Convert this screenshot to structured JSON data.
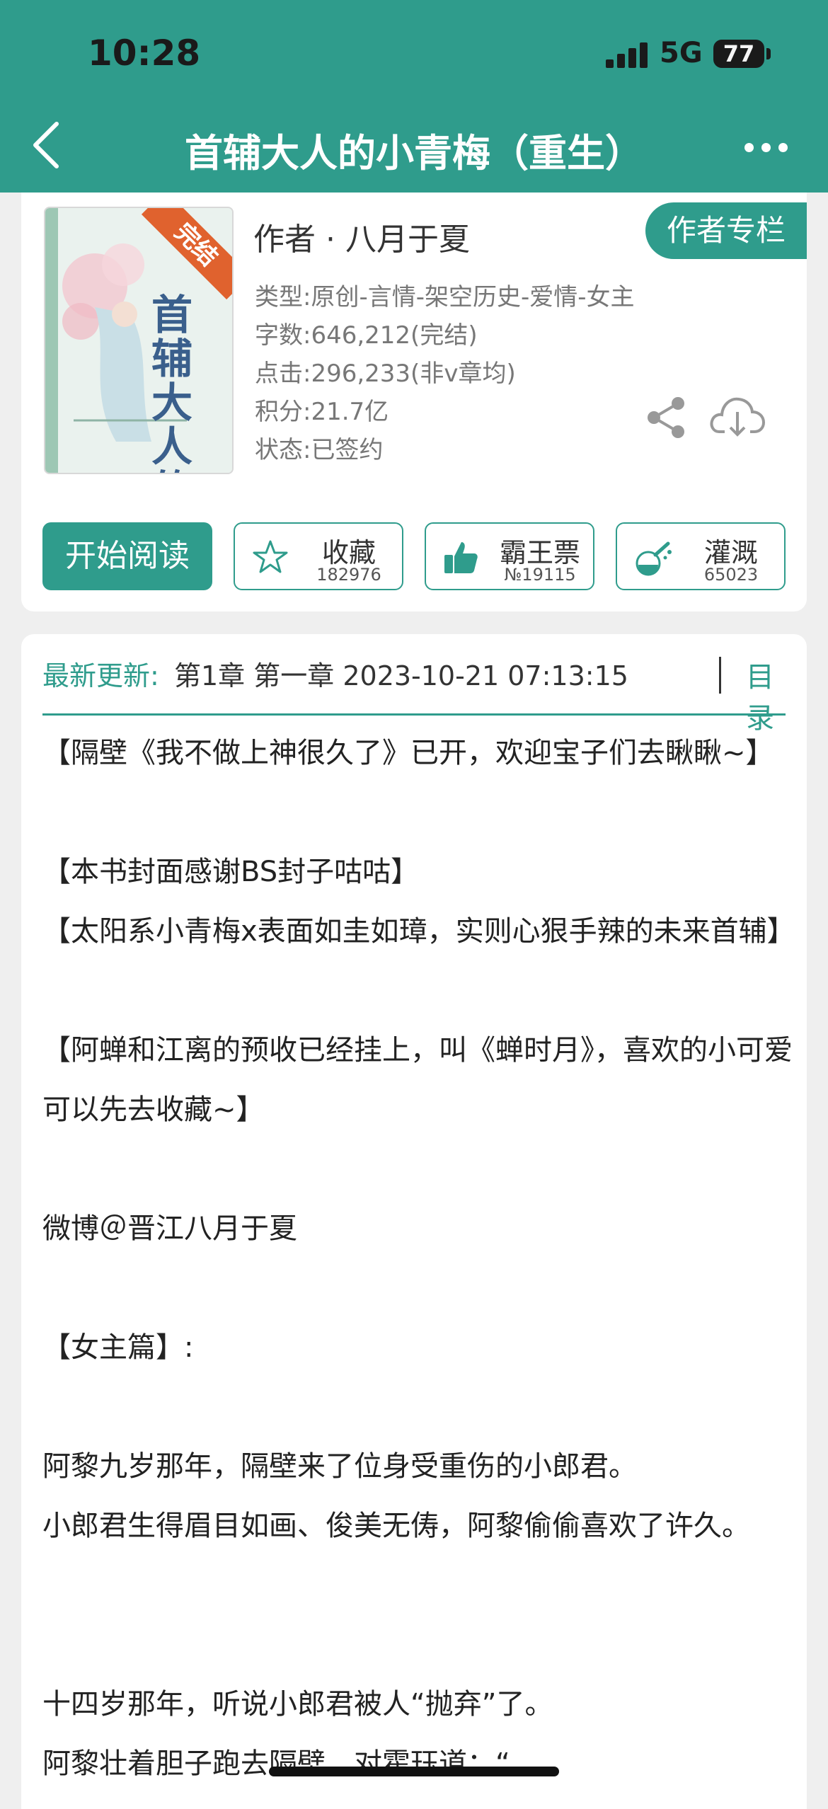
{
  "status_bar": {
    "time": "10:28",
    "network": "5G",
    "battery": "77"
  },
  "nav": {
    "title": "首辅大人的小青梅（重生）"
  },
  "book": {
    "cover_badge": "完结",
    "cover_title": "首辅大人的小青梅",
    "author_line": "作者 · 八月于夏",
    "author_column_label": "作者专栏",
    "meta": [
      "类型:原创-言情-架空历史-爱情-女主",
      "字数:646,212(完结)",
      "点击:296,233(非v章均)",
      "积分:21.7亿",
      "状态:已签约"
    ]
  },
  "actions": {
    "read_label": "开始阅读",
    "buttons": [
      {
        "label": "收藏",
        "count": "182976",
        "icon": "star-icon"
      },
      {
        "label": "霸王票",
        "count": "№19115",
        "icon": "thumbs-up-icon"
      },
      {
        "label": "灌溉",
        "count": "65023",
        "icon": "nutrient-bottle-icon"
      }
    ]
  },
  "update": {
    "label": "最新更新:",
    "text": "第1章 第一章 2023-10-21 07:13:15",
    "toc_label": "目录"
  },
  "content": {
    "p1": "【隔壁《我不做上神很久了》已开，欢迎宝子们去瞅瞅~】",
    "p2": "【本书封面感谢BS封子咕咕】",
    "p3": "【太阳系小青梅x表面如圭如璋，实则心狠手辣的未来首辅】",
    "p4": "【阿蝉和江离的预收已经挂上，叫《蝉时月》，喜欢的小可爱可以先去收藏~】",
    "p5": "微博＠晋江八月于夏",
    "p6": "【女主篇】:",
    "p7": "阿黎九岁那年，隔壁来了位身受重伤的小郎君。",
    "p8": "小郎君生得眉目如画、俊美无俦，阿黎偷偷喜欢了许久。",
    "p9": "十四岁那年，听说小郎君被人“抛弃”了。",
    "p10": "阿黎壮着胆子跑去隔壁，对霍珏道：“"
  },
  "colors": {
    "accent": "#2f9c8c",
    "badge": "#e0622e"
  }
}
